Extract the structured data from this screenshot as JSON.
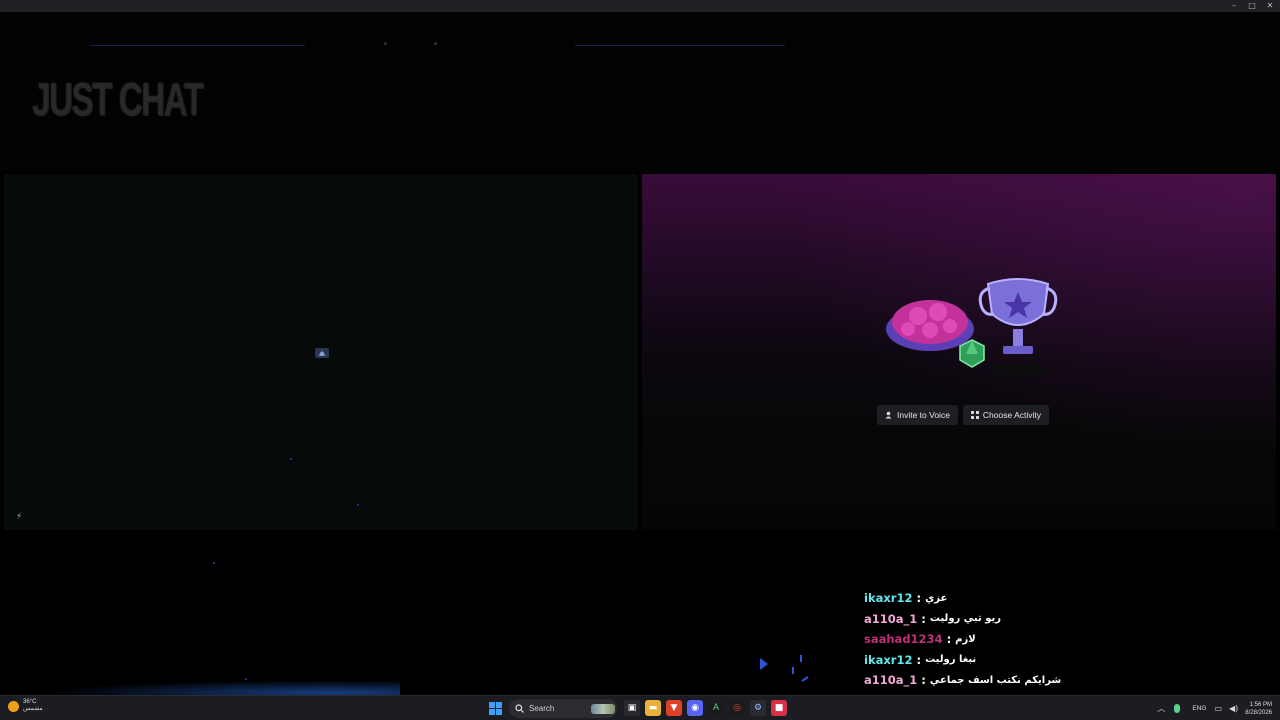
{
  "overlay": {
    "logo_text": "JUST CHAT"
  },
  "voice": {
    "invite_label": "Invite to Voice",
    "activity_label": "Choose Activity"
  },
  "chat": [
    {
      "user": "ikaxr12",
      "sep": ":",
      "msg": "عزي",
      "color": "#5fe8ee"
    },
    {
      "user": "a110a_1",
      "sep": ":",
      "msg": "ريو تبي روليت",
      "color": "#f2a8d8"
    },
    {
      "user": "saahad1234",
      "sep": ":",
      "msg": "لازم",
      "color": "#c0307a"
    },
    {
      "user": "ikaxr12",
      "sep": ":",
      "msg": "نبغا روليت",
      "color": "#5fe8ee"
    },
    {
      "user": "a110a_1",
      "sep": ":",
      "msg": "شرايكم نكتب اسف جماعي",
      "color": "#f2a8d8"
    }
  ],
  "taskbar": {
    "weather_temp": "36°C",
    "weather_desc": "مشمس",
    "search_label": "Search",
    "lang": "ENG",
    "time": "1:56 PM",
    "date": "8/28/2026"
  },
  "colors": {
    "accent_purple": "#3a0c3a",
    "taskbar_bg": "#1c1d22",
    "win_start": "#3fa0ff"
  }
}
